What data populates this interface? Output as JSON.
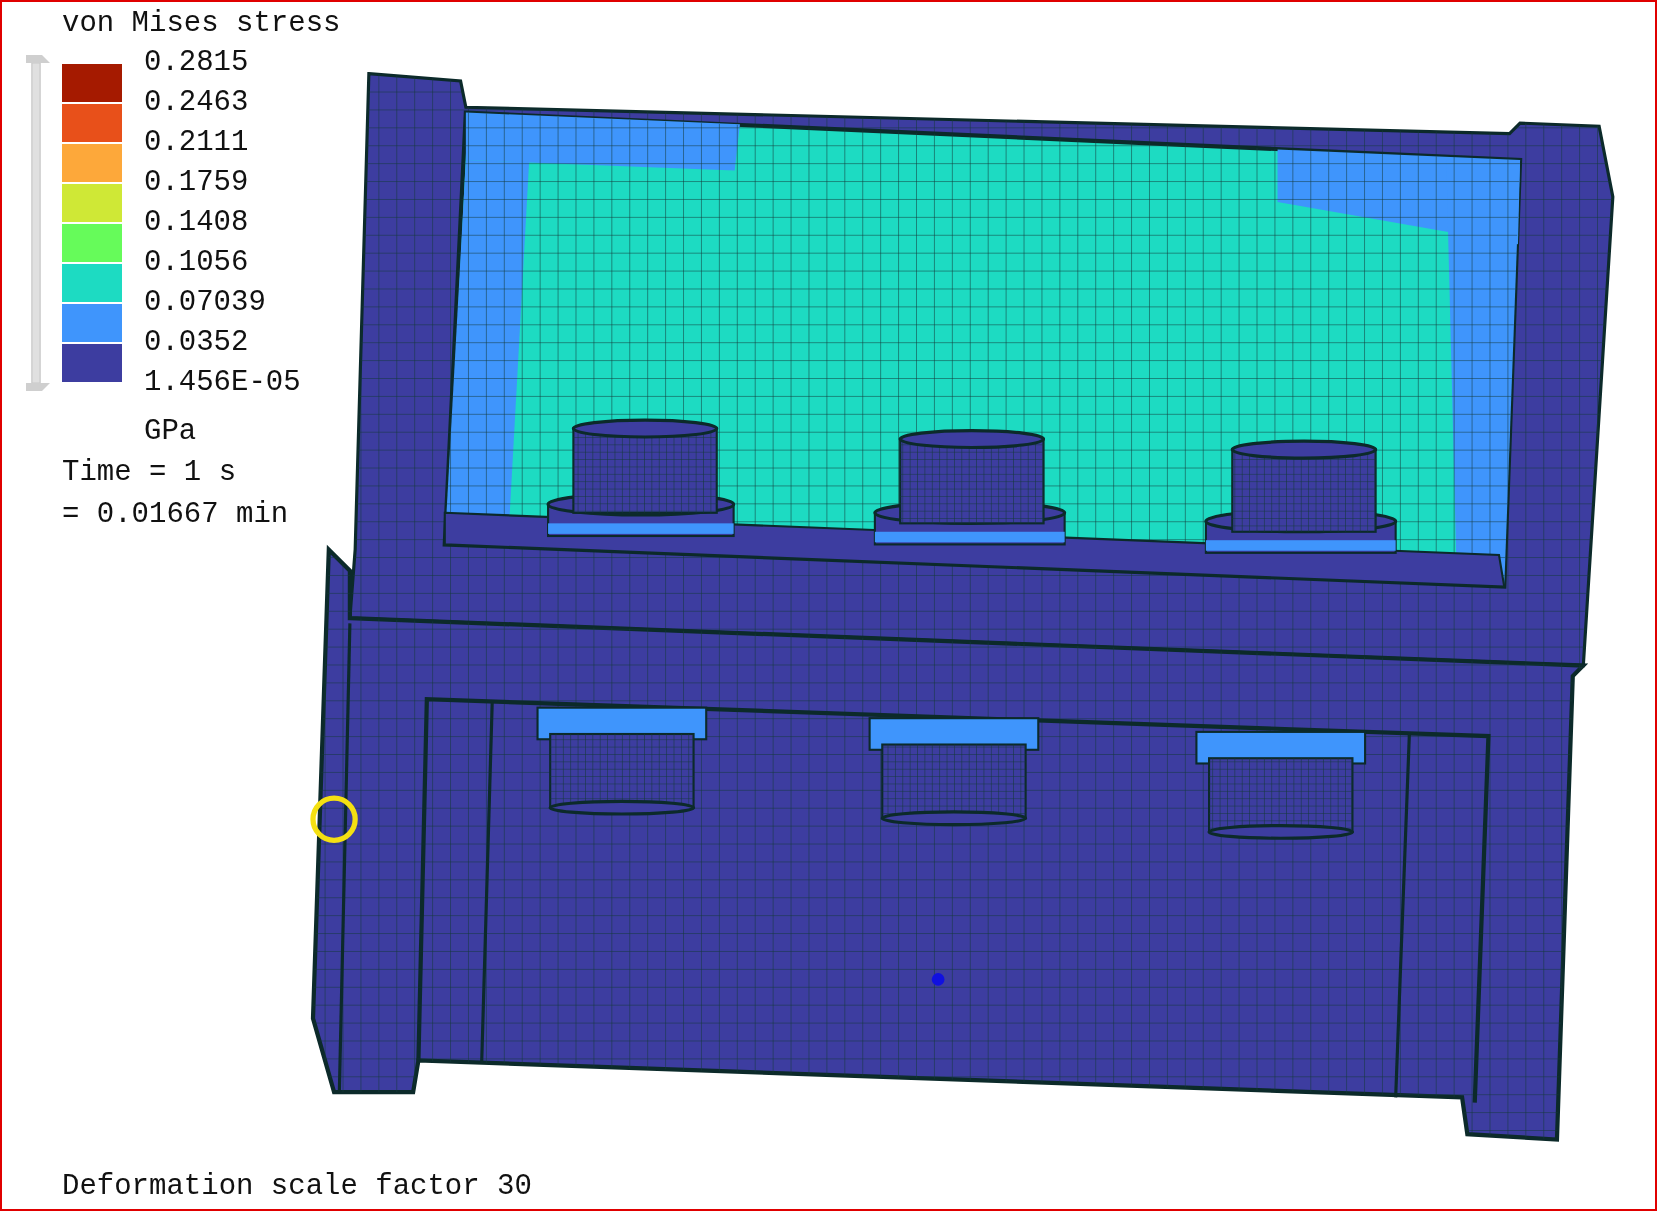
{
  "legend": {
    "title": "von Mises stress",
    "bands": [
      {
        "color": "#a51a00"
      },
      {
        "color": "#e8501a"
      },
      {
        "color": "#fda83a"
      },
      {
        "color": "#cfe836"
      },
      {
        "color": "#66fb5a"
      },
      {
        "color": "#1ddbc2"
      },
      {
        "color": "#3f95fc"
      },
      {
        "color": "#3d3da0"
      }
    ],
    "ticks": [
      "0.2815",
      "0.2463",
      "0.2111",
      "0.1759",
      "0.1408",
      "0.1056",
      "0.07039",
      "0.0352",
      "1.456E-05"
    ],
    "unit": "GPa",
    "range_slider": {
      "level": 1
    }
  },
  "time": {
    "line_1": "Time = 1 s",
    "line_2": "= 0.01667 min"
  },
  "footer": "Deformation scale factor 30"
}
